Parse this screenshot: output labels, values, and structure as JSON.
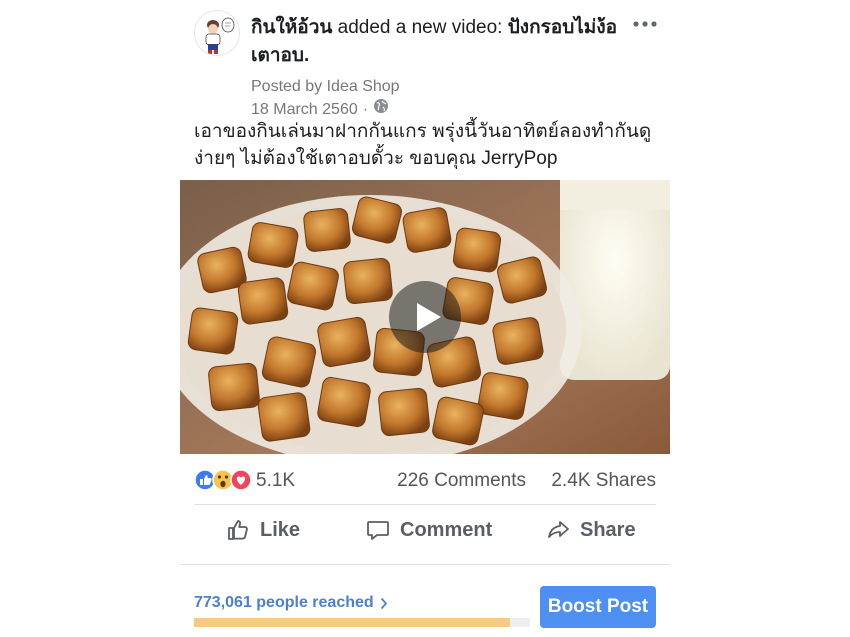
{
  "post": {
    "author": "กินให้อ้วน",
    "action_text": " added a new video: ",
    "video_title": "ปังกรอบไม่ง้อเตาอบ.",
    "posted_by": "Posted by Idea Shop",
    "date": "18 March 2560",
    "separator": "·",
    "privacy_icon": "globe-icon",
    "more_icon": "more-horizontal-icon",
    "caption": "เอาของกินเล่นมาฝากกันแกร พรุ่งนี้วันอาทิตย์ลองทำกันดู ง่ายๆ ไม่ต้องใช้เตาอบดั้วะ ขอบคุณ JerryPop"
  },
  "video": {
    "play_icon": "play-icon"
  },
  "stats": {
    "reaction_icons": [
      "like-icon",
      "wow-icon",
      "love-icon"
    ],
    "reactions": "5.1K",
    "comments": "226 Comments",
    "shares": "2.4K Shares"
  },
  "actions": {
    "like": "Like",
    "comment": "Comment",
    "share": "Share"
  },
  "footer": {
    "reach": "773,061 people reached",
    "reach_fraction": 0.94,
    "boost_label": "Boost Post"
  },
  "colors": {
    "boost_blue": "#4e8ff2",
    "reach_link": "#4d7fd1",
    "reach_fill": "#f8c983"
  }
}
